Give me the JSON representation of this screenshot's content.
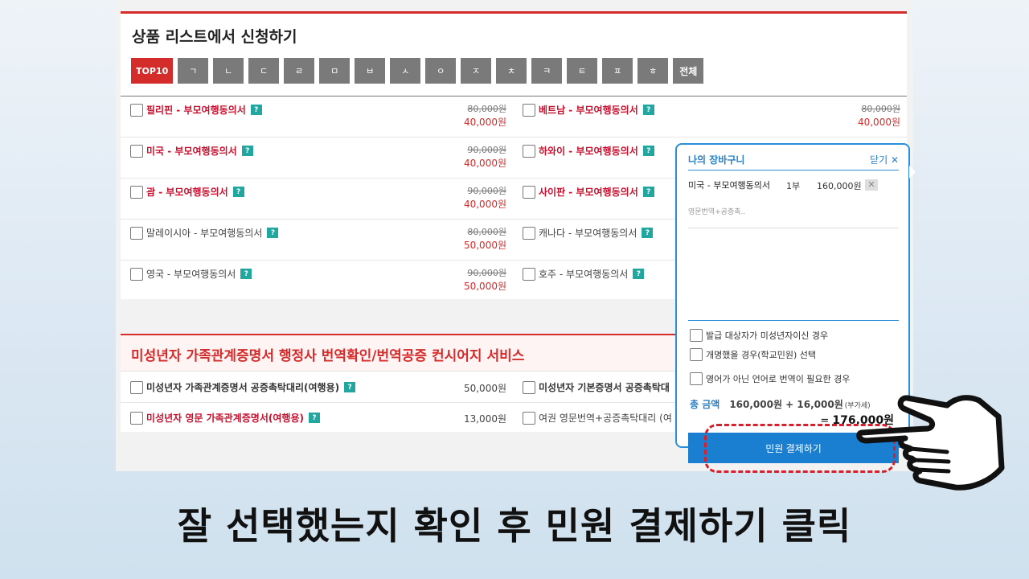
{
  "section1": {
    "title": "상품 리스트에서 신청하기",
    "filters": [
      "TOP10",
      "ㄱ",
      "ㄴ",
      "ㄷ",
      "ㄹ",
      "ㅁ",
      "ㅂ",
      "ㅅ",
      "ㅇ",
      "ㅈ",
      "ㅊ",
      "ㅋ",
      "ㅌ",
      "ㅍ",
      "ㅎ",
      "전체"
    ],
    "rows": [
      {
        "left": {
          "name": "필리핀 - 부모여행동의서",
          "old": "80,000원",
          "new": "40,000원"
        },
        "right": {
          "name": "베트남 - 부모여행동의서",
          "old": "80,000원",
          "new": "40,000원"
        }
      },
      {
        "left": {
          "name": "미국 - 부모여행동의서",
          "old": "90,000원",
          "new": "40,000원"
        },
        "right": {
          "name": "하와이 - 부모여행동의서"
        }
      },
      {
        "left": {
          "name": "괌 - 부모여행동의서",
          "old": "90,000원",
          "new": "40,000원"
        },
        "right": {
          "name": "사이판 - 부모여행동의서"
        }
      },
      {
        "left": {
          "name": "말레이시아 - 부모여행동의서",
          "old": "80,000원",
          "new": "50,000원"
        },
        "right": {
          "name": "캐나다 - 부모여행동의서"
        }
      },
      {
        "left": {
          "name": "영국 - 부모여행동의서",
          "old": "90,000원",
          "new": "50,000원"
        },
        "right": {
          "name": "호주 - 부모여행동의서"
        }
      }
    ],
    "help_glyph": "?"
  },
  "section2": {
    "title": "미성년자 가족관계증명서 행정사 번역확인/번역공증 컨시어지 서비스",
    "rows": [
      {
        "left": {
          "name": "미성년자 가족관계증명서 공증촉탁대리(여행용)",
          "price": "50,000원"
        },
        "right": {
          "name": "미성년자 기본증명서 공증촉탁대"
        }
      },
      {
        "left": {
          "name": "미성년자 영문 가족관계증명서(여행용)",
          "price": "13,000원"
        },
        "right": {
          "name": "여권 영문번역+공증촉탁대리 (여"
        }
      }
    ]
  },
  "cart": {
    "title": "나의 장바구니",
    "close": "닫기 ✕",
    "item": {
      "name": "미국 - 부모여행동의서",
      "sub": "영문번역+공증촉..",
      "qty": "1부",
      "price": "160,000원",
      "delete": "✕"
    },
    "options": [
      "발급 대상자가 미성년자이신 경우",
      "개명했을 경우(학교민원) 선택",
      "영어가 아닌 언어로 번역이 필요한 경우"
    ],
    "total_label": "총 금액",
    "total_expr": "160,000원 + 16,000원",
    "total_vat": "(부가세)",
    "total_prefix": "= ",
    "total_sum": "176,000원",
    "pay_button": "민원 결제하기"
  },
  "caption": "잘 선택했는지 확인 후 민원 결제하기 클릭",
  "colors": {
    "accent_red": "#d42b2b",
    "cart_blue": "#2a8ed8",
    "pay_blue": "#1b7fd1",
    "help_teal": "#21a7a0",
    "filter_gray": "#7a7a7a"
  },
  "icons": [
    "checkbox-icon",
    "help-icon",
    "close-icon",
    "delete-icon",
    "pointing-hand-icon"
  ]
}
